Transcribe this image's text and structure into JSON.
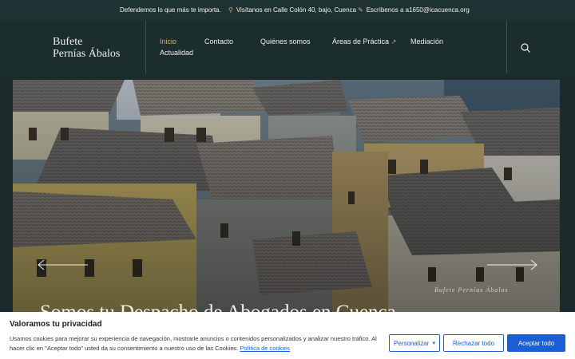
{
  "topbar": {
    "tagline": "Defendemos lo que más te importa.",
    "address": "Visítanos en Calle Colón 40, bajo, Cuenca",
    "email": "Escríbenos a a1650@icacuenca.org"
  },
  "header": {
    "logo_line1": "Bufete",
    "logo_line2": "Pernías Ábalos",
    "nav": {
      "inicio": "Inicio",
      "contacto": "Contacto",
      "quienes": "Quiénes somos",
      "areas": "Áreas de Práctica",
      "mediacion": "Mediación",
      "actualidad": "Actualidad"
    }
  },
  "hero": {
    "watermark": "Bufete Pernías Ábalos",
    "title": "Somos tu Despacho de Abogados en Cuenca"
  },
  "cookie": {
    "title": "Valoramos tu privacidad",
    "text": "Usamos cookies para mejorar su experiencia de navegación, mostrarle anuncios o contenidos personalizados y analizar nuestro tráfico. Al hacer clic en \"Aceptar todo\" usted da su consentimiento a nuestro uso de las Cookies.",
    "policy_link": "Política de cookies",
    "personalize": "Personalizar",
    "reject": "Rechazar todo",
    "accept": "Aceptar todo"
  },
  "colors": {
    "accent": "#c9b27a",
    "primary_button": "#1c5fd4",
    "header_bg": "#1c2d2e"
  }
}
